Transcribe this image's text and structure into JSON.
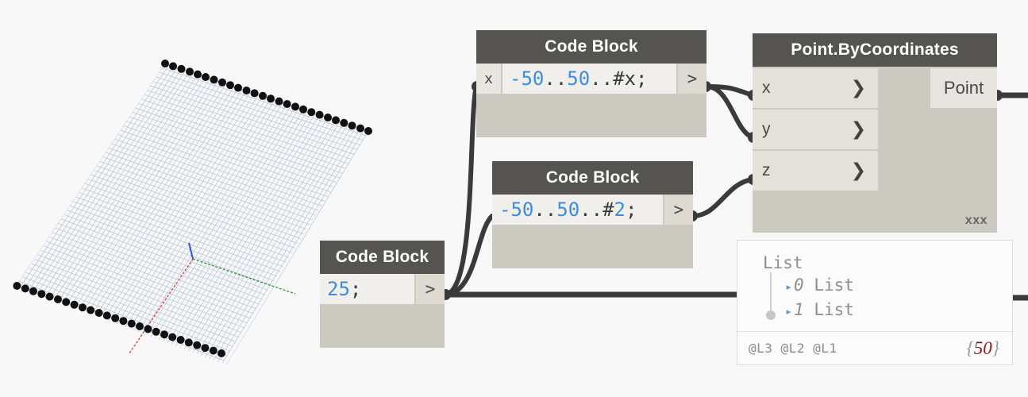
{
  "app": {
    "canvas_background": "#f8f8f8",
    "node_header_color": "#565450",
    "node_body_color": "#ccc9c0",
    "wire_color": "#3a3a3a",
    "code_number_color": "#3e8ddd"
  },
  "viewport": {
    "name": "background-3d-preview",
    "geometry": "tilted rectangular point grid",
    "axis_colors": {
      "x": "#d04a4a",
      "y": "#3f8f3f",
      "z": "#3a4fd0"
    },
    "grid_color": "#b9c7d6",
    "point_color": "#111111"
  },
  "nodes": [
    {
      "id": "code-block-x",
      "title": "Code Block",
      "input_port": "x",
      "code": "-50..50..#x;",
      "code_tokens": [
        {
          "t": "-50",
          "k": "num"
        },
        {
          "t": "..",
          "k": "pun"
        },
        {
          "t": "50",
          "k": "num"
        },
        {
          "t": "..#x",
          "k": "pun"
        },
        {
          "t": ";",
          "k": "pun"
        }
      ],
      "output_label": ">"
    },
    {
      "id": "code-block-2",
      "title": "Code Block",
      "code": "-50..50..#2;",
      "code_tokens": [
        {
          "t": "-50",
          "k": "num"
        },
        {
          "t": "..",
          "k": "pun"
        },
        {
          "t": "50",
          "k": "num"
        },
        {
          "t": "..#",
          "k": "pun"
        },
        {
          "t": "2",
          "k": "num"
        },
        {
          "t": ";",
          "k": "pun"
        }
      ],
      "output_label": ">"
    },
    {
      "id": "code-block-25",
      "title": "Code Block",
      "code": "25;",
      "code_tokens": [
        {
          "t": "25",
          "k": "num"
        },
        {
          "t": ";",
          "k": "pun"
        }
      ],
      "output_label": ">"
    },
    {
      "id": "point-bycoordinates",
      "title": "Point.ByCoordinates",
      "inputs": [
        {
          "name": "x",
          "chevron": "❯"
        },
        {
          "name": "y",
          "chevron": "❯"
        },
        {
          "name": "z",
          "chevron": "❯"
        }
      ],
      "output": "Point",
      "lacing": "xxx"
    }
  ],
  "watch": {
    "root_label": "List",
    "items": [
      {
        "expander": "▸",
        "index": "0",
        "label": "List"
      },
      {
        "expander": "▸",
        "index": "1",
        "label": "List"
      }
    ],
    "levels": "@L3 @L2 @L1",
    "count_open": "{",
    "count_value": "50",
    "count_close": "}"
  }
}
